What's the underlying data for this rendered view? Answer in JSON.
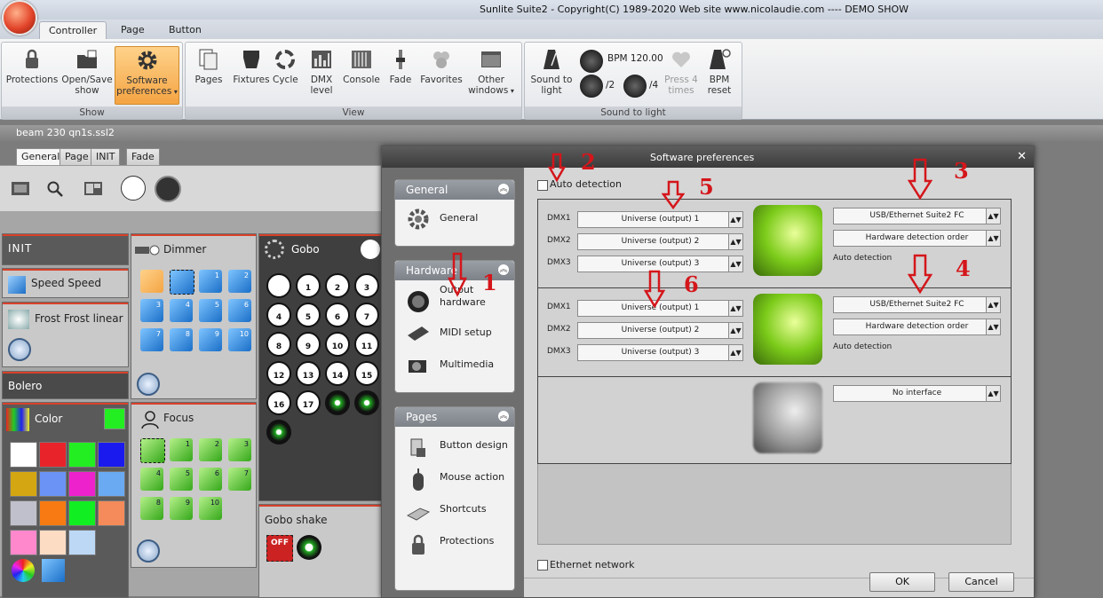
{
  "window": {
    "title": "Sunlite Suite2 - Copyright(C) 1989-2020    Web site www.nicolaudie.com ---- DEMO SHOW"
  },
  "ribbon_tabs": [
    "Controller",
    "Page",
    "Button"
  ],
  "ribbon": {
    "show": {
      "label": "Show",
      "buttons": [
        "Protections",
        "Open/Save show",
        "Software preferences"
      ]
    },
    "view": {
      "label": "View",
      "buttons": [
        "Pages",
        "Fixtures",
        "Cycle",
        "DMX level",
        "Console",
        "Fade",
        "Favorites",
        "Other windows"
      ]
    },
    "sound": {
      "label": "Sound to light",
      "sound_to_light": "Sound to light",
      "bpm": "BPM 120.00",
      "div2": "/2",
      "div4": "/4",
      "press4": "Press 4 times",
      "bpm_reset": "BPM reset"
    }
  },
  "file": {
    "name": "beam 230 qn1s.ssl2"
  },
  "page_tabs": [
    "General",
    "Page",
    "INIT",
    "Fade"
  ],
  "panels": {
    "init": "INIT",
    "speed": "Speed Speed",
    "frost": "Frost Frost linear",
    "bolero": "Bolero",
    "color": "Color",
    "dimmer": "Dimmer",
    "focus": "Focus",
    "gobo": "Gobo",
    "gobo_shake": "Gobo shake",
    "gobo_shake_off": "OFF"
  },
  "dimmer_tiles": [
    "",
    "",
    "1",
    "2",
    "3",
    "4",
    "5",
    "6",
    "7",
    "8",
    "9",
    "10"
  ],
  "focus_tiles": [
    "",
    "1",
    "2",
    "3",
    "4",
    "5",
    "6",
    "7",
    "8",
    "9",
    "10"
  ],
  "gobo_tiles": [
    "",
    "1",
    "2",
    "3",
    "4",
    "5",
    "6",
    "7",
    "8",
    "9",
    "10",
    "11",
    "12",
    "13",
    "14",
    "15",
    "16",
    "17",
    "",
    ""
  ],
  "color_swatches": [
    "#ffffff",
    "#e8232a",
    "#22ee22",
    "#1a1aee",
    "#d4a712",
    "#6b93f5",
    "#ee22cc",
    "#6aaaf2",
    "#c0c0cc",
    "#f77b12",
    "#11ee22",
    "#f58a5a",
    "#ff88cc",
    "#fddcc4",
    "#bcd8f5"
  ],
  "dialog": {
    "title": "Software preferences",
    "close": "✕",
    "categories": {
      "general": {
        "title": "General",
        "items": [
          "General"
        ]
      },
      "hardware": {
        "title": "Hardware",
        "items": [
          "Output hardware",
          "MIDI setup",
          "Multimedia"
        ]
      },
      "pages": {
        "title": "Pages",
        "items": [
          "Button design",
          "Mouse action",
          "Shortcuts",
          "Protections"
        ]
      }
    },
    "auto_detection_label": "Auto detection",
    "interfaces": [
      {
        "dmx": [
          {
            "label": "DMX1",
            "value": "Universe (output) 1"
          },
          {
            "label": "DMX2",
            "value": "Universe (output) 2"
          },
          {
            "label": "DMX3",
            "value": "Universe (output) 3"
          }
        ],
        "device": "USB/Ethernet Suite2 FC",
        "order": "Hardware detection order",
        "note": "Auto detection"
      },
      {
        "dmx": [
          {
            "label": "DMX1",
            "value": "Universe (output) 1"
          },
          {
            "label": "DMX2",
            "value": "Universe (output) 2"
          },
          {
            "label": "DMX3",
            "value": "Universe (output) 3"
          }
        ],
        "device": "USB/Ethernet Suite2 FC",
        "order": "Hardware detection order",
        "note": "Auto detection"
      },
      {
        "device": "No interface"
      }
    ],
    "ethernet_label": "Ethernet network",
    "ok": "OK",
    "cancel": "Cancel"
  },
  "annotations": [
    "1",
    "2",
    "3",
    "4",
    "5",
    "6"
  ],
  "colors": {
    "accent_red": "#d4161b",
    "selected_orange": "#f4a443",
    "panel_red": "#d8402a"
  }
}
